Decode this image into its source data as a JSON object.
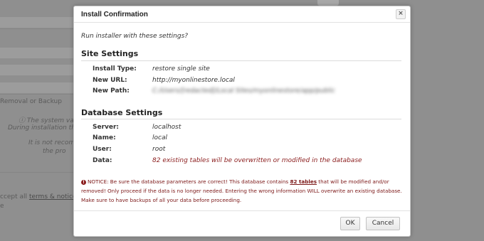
{
  "background": {
    "section_label": "Removal or Backup",
    "hint1": "The system vali",
    "hint2": "During installation the",
    "hint3": "It is not recomm",
    "hint4": "the pro",
    "accept_prefix": "ccept all",
    "terms_link": "terms & notice",
    "stub": "e"
  },
  "dialog": {
    "title": "Install Confirmation",
    "close_glyph": "×",
    "prompt": "Run installer with these settings?",
    "site": {
      "heading": "Site Settings",
      "install_type_label": "Install Type:",
      "install_type_value": "restore single site",
      "new_url_label": "New URL:",
      "new_url_value": "http://myonlinestore.local",
      "new_path_label": "New Path:",
      "new_path_value": "C:/Users/[redacted]/Local Sites/myonlinestore/app/public"
    },
    "database": {
      "heading": "Database Settings",
      "server_label": "Server:",
      "server_value": "localhost",
      "name_label": "Name:",
      "name_value": "local",
      "user_label": "User:",
      "user_value": "root",
      "data_label": "Data:",
      "data_value": "82 existing tables will be overwritten or modified in the database"
    },
    "notice": {
      "icon": "!",
      "part1": "NOTICE: Be sure the database parameters are correct! This database contains ",
      "tables_link": "82 tables",
      "part2": " that will be modified and/or removed! Only proceed if the data is no longer needed. Entering the wrong information WILL overwrite an existing database. Make sure to have backups of all your data before proceeding."
    },
    "ok_label": "OK",
    "cancel_label": "Cancel"
  },
  "colors": {
    "overlay": "#8f8f8f",
    "warning": "#8b1d1d"
  }
}
